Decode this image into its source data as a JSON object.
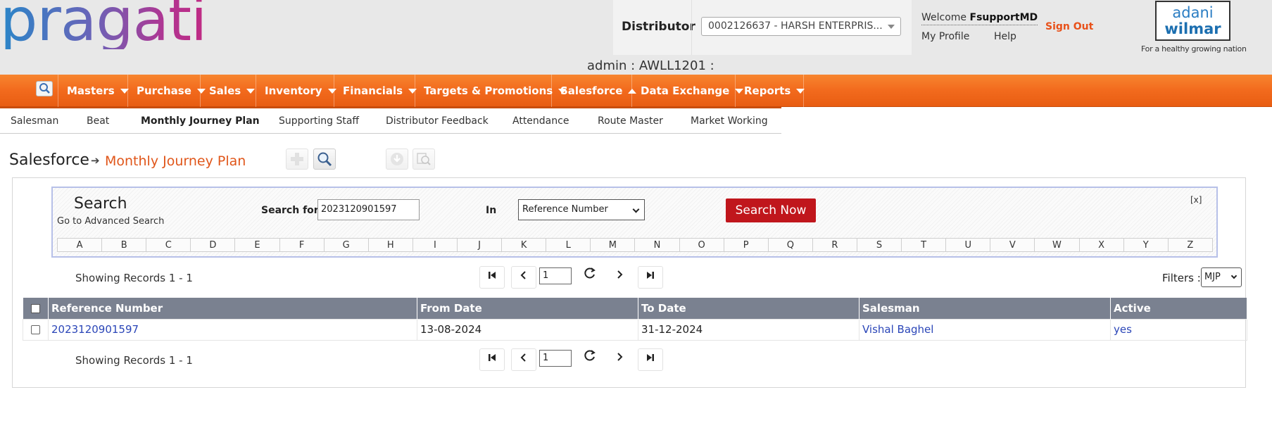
{
  "header": {
    "logo_text": "pragati",
    "admin_line": "admin : AWLL1201 :",
    "distributor_label": "Distributor",
    "distributor_value": "0002126637 - HARSH ENTERPRIS...",
    "welcome_prefix": "Welcome ",
    "welcome_user": "FsupportMD",
    "my_profile": "My Profile",
    "help": "Help",
    "sign_out": "Sign Out",
    "brand_top": "adani",
    "brand_bottom": "wilmar",
    "brand_tagline": "For a healthy growing nation"
  },
  "nav": {
    "items": [
      {
        "label": "Masters",
        "caret": "down"
      },
      {
        "label": "Purchase",
        "caret": "down"
      },
      {
        "label": "Sales",
        "caret": "down"
      },
      {
        "label": "Inventory",
        "caret": "down"
      },
      {
        "label": "Financials",
        "caret": "down"
      },
      {
        "label": "Targets & Promotions",
        "caret": "down"
      },
      {
        "label": "Salesforce",
        "caret": "up"
      },
      {
        "label": "Data Exchange",
        "caret": "down"
      },
      {
        "label": "Reports",
        "caret": "down"
      }
    ]
  },
  "subnav": {
    "items": [
      "Salesman",
      "Beat",
      "Monthly Journey Plan",
      "Supporting Staff",
      "Distributor Feedback",
      "Attendance",
      "Route Master",
      "Market Working"
    ],
    "active": "Monthly Journey Plan"
  },
  "breadcrumb": {
    "section": "Salesforce",
    "arrow": "➔",
    "page": "Monthly Journey Plan"
  },
  "search": {
    "title": "Search",
    "advanced_link": "Go to Advanced Search",
    "search_for_label": "Search for",
    "search_value": "2023120901597",
    "in_label": "In",
    "in_value": "Reference Number",
    "button": "Search Now",
    "close": "[x]",
    "letters": [
      "A",
      "B",
      "C",
      "D",
      "E",
      "F",
      "G",
      "H",
      "I",
      "J",
      "K",
      "L",
      "M",
      "N",
      "O",
      "P",
      "Q",
      "R",
      "S",
      "T",
      "U",
      "V",
      "W",
      "X",
      "Y",
      "Z"
    ]
  },
  "pager": {
    "showing": "Showing Records 1 - 1",
    "page": "1",
    "filters_label": "Filters :",
    "filters_value": "MJP"
  },
  "table": {
    "columns": [
      "Reference Number",
      "From Date",
      "To Date",
      "Salesman",
      "Active"
    ],
    "rows": [
      {
        "reference": "2023120901597",
        "from": "13-08-2024",
        "to": "31-12-2024",
        "salesman": "Vishal Baghel",
        "active": "yes"
      }
    ]
  },
  "colors": {
    "nav_orange": "#f26a1d",
    "accent_orange": "#e0561a",
    "search_button": "#c0161c",
    "table_header": "#7a8190",
    "link_blue": "#2b46b8"
  }
}
